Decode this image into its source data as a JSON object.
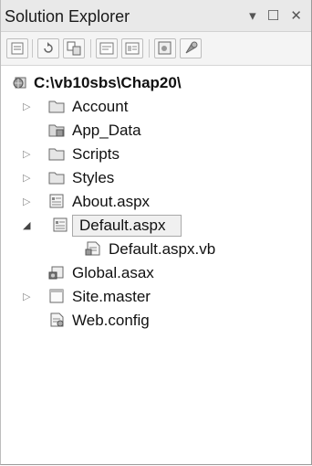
{
  "panel": {
    "title": "Solution Explorer",
    "controls": "▾ ☐ ✕"
  },
  "toolbar": {
    "buttons": [
      "properties-icon",
      "refresh-icon",
      "nest-files-icon",
      "view-code-icon",
      "view-designer-icon",
      "copy-website-icon",
      "aspnet-config-icon"
    ]
  },
  "tree": {
    "root": "C:\\vb10sbs\\Chap20\\",
    "items": [
      {
        "label": "Account",
        "icon": "folder-icon",
        "expander": "▷"
      },
      {
        "label": "App_Data",
        "icon": "app-data-folder-icon",
        "expander": ""
      },
      {
        "label": "Scripts",
        "icon": "folder-icon",
        "expander": "▷"
      },
      {
        "label": "Styles",
        "icon": "folder-icon",
        "expander": "▷"
      },
      {
        "label": "About.aspx",
        "icon": "aspx-page-icon",
        "expander": "▷"
      },
      {
        "label": "Default.aspx",
        "icon": "aspx-page-icon",
        "expander": "◢",
        "selected": true
      },
      {
        "label": "Default.aspx.vb",
        "icon": "vb-code-file-icon",
        "expander": ""
      },
      {
        "label": "Global.asax",
        "icon": "global-asax-icon",
        "expander": ""
      },
      {
        "label": "Site.master",
        "icon": "master-page-icon",
        "expander": "▷"
      },
      {
        "label": "Web.config",
        "icon": "config-file-icon",
        "expander": ""
      }
    ]
  }
}
